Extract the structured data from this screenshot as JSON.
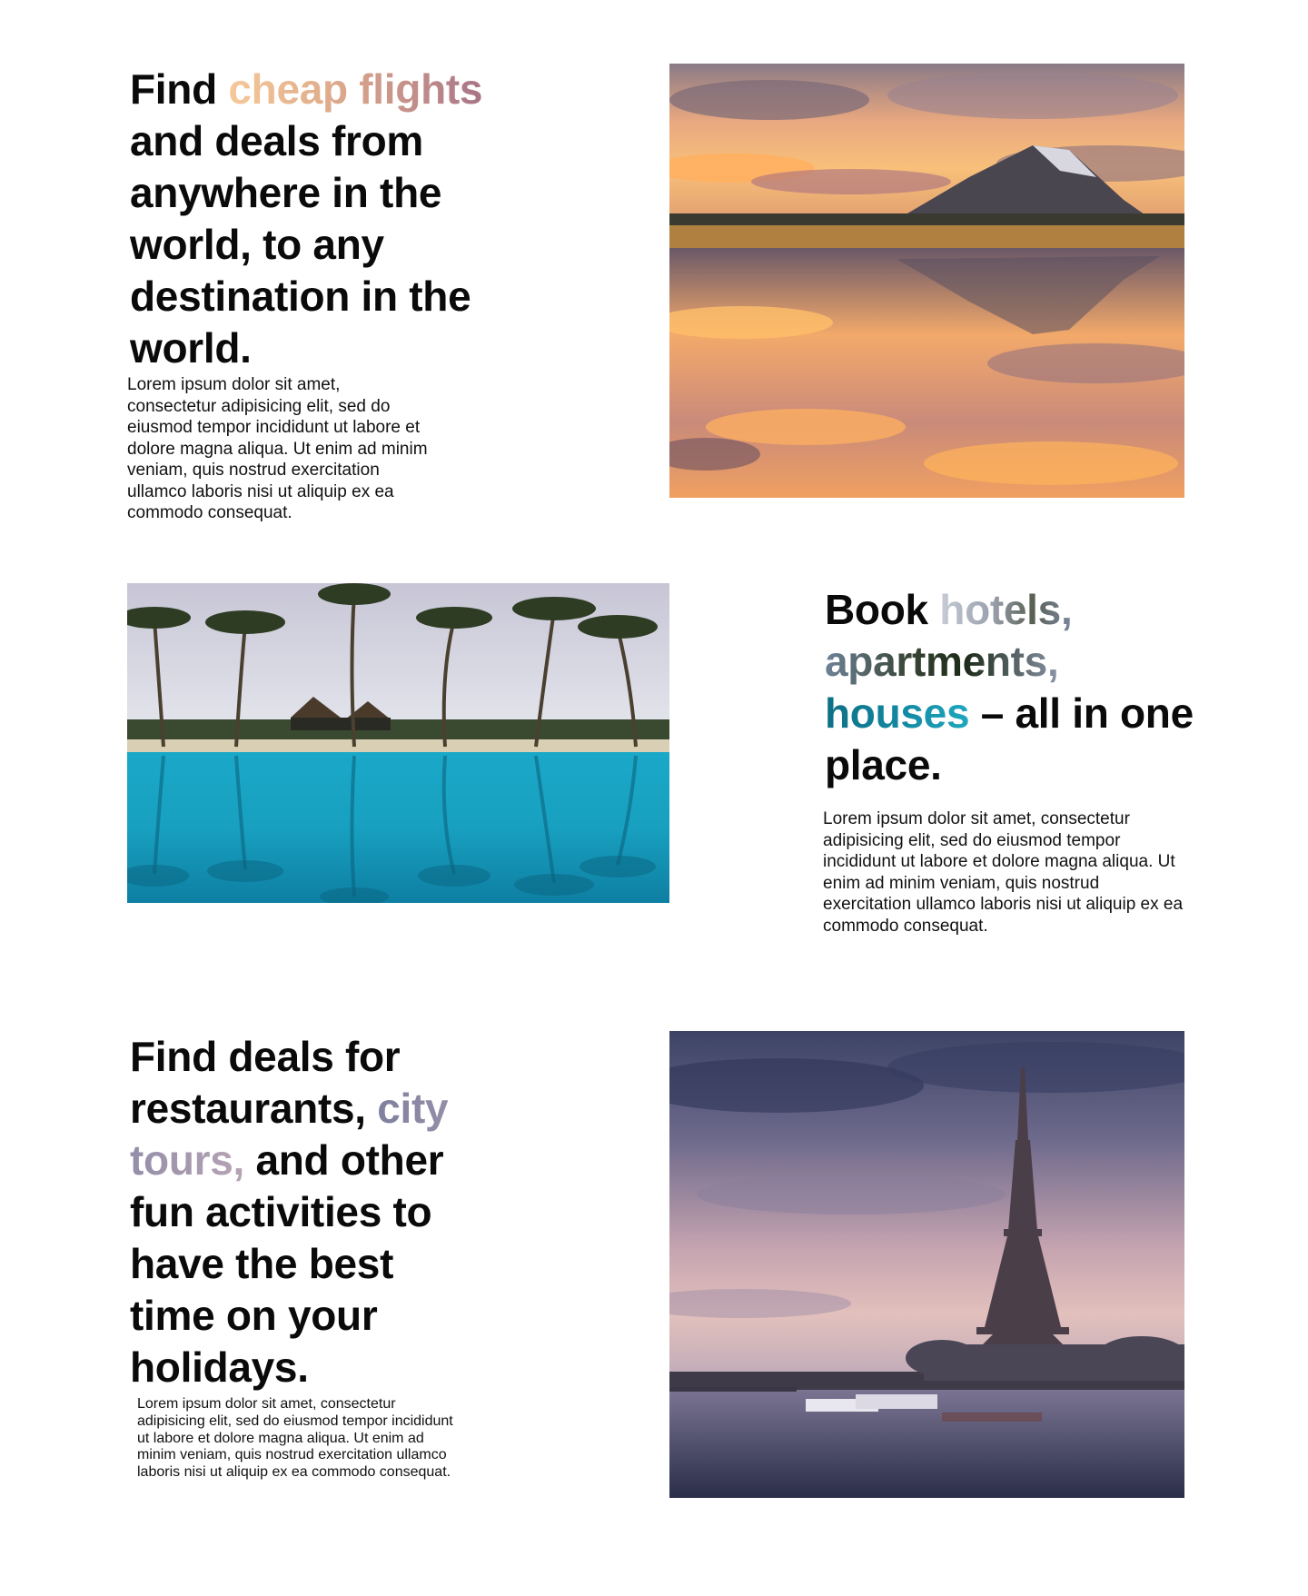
{
  "sections": [
    {
      "heading_before": "Find ",
      "heading_highlight": "cheap flights",
      "heading_after": " and deals from anywhere in the world, to any destination in the world.",
      "paragraph": "Lorem ipsum dolor sit amet, consectetur adipisicing elit, sed do eiusmod tempor incididunt ut labore et dolore magna aliqua. Ut enim ad minim veniam, quis nostrud exercitation ullamco laboris nisi ut aliquip ex ea commodo consequat.",
      "image_icon": "mountain-lake-sunset-photo"
    },
    {
      "heading_before": "Book ",
      "heading_highlight_1": "hotels,",
      "heading_highlight_2": "apartments,",
      "heading_highlight_3": "houses",
      "heading_after": " – all in one place.",
      "paragraph": "Lorem ipsum dolor sit amet, consectetur adipisicing elit, sed do eiusmod tempor incididunt ut labore et dolore magna aliqua. Ut enim ad minim veniam, quis nostrud exercitation ullamco laboris nisi ut aliquip ex ea commodo consequat.",
      "image_icon": "tropical-pool-palms-photo"
    },
    {
      "heading_before": "Find deals for restaurants, ",
      "heading_highlight": "city tours,",
      "heading_after": " and other fun activities to have the best time on your holidays.",
      "paragraph": "Lorem ipsum dolor sit amet, consectetur adipisicing elit, sed do eiusmod tempor incididunt ut labore et dolore magna aliqua. Ut enim ad minim veniam, quis nostrud exercitation ullamco laboris nisi ut aliquip ex ea commodo consequat.",
      "image_icon": "eiffel-tower-dusk-photo"
    }
  ],
  "colors": {
    "text": "#0a0a0a",
    "background": "#ffffff",
    "sunset_accent": "#e2b08c",
    "pool_accent": "#1287a0",
    "paris_accent": "#9890aa"
  }
}
